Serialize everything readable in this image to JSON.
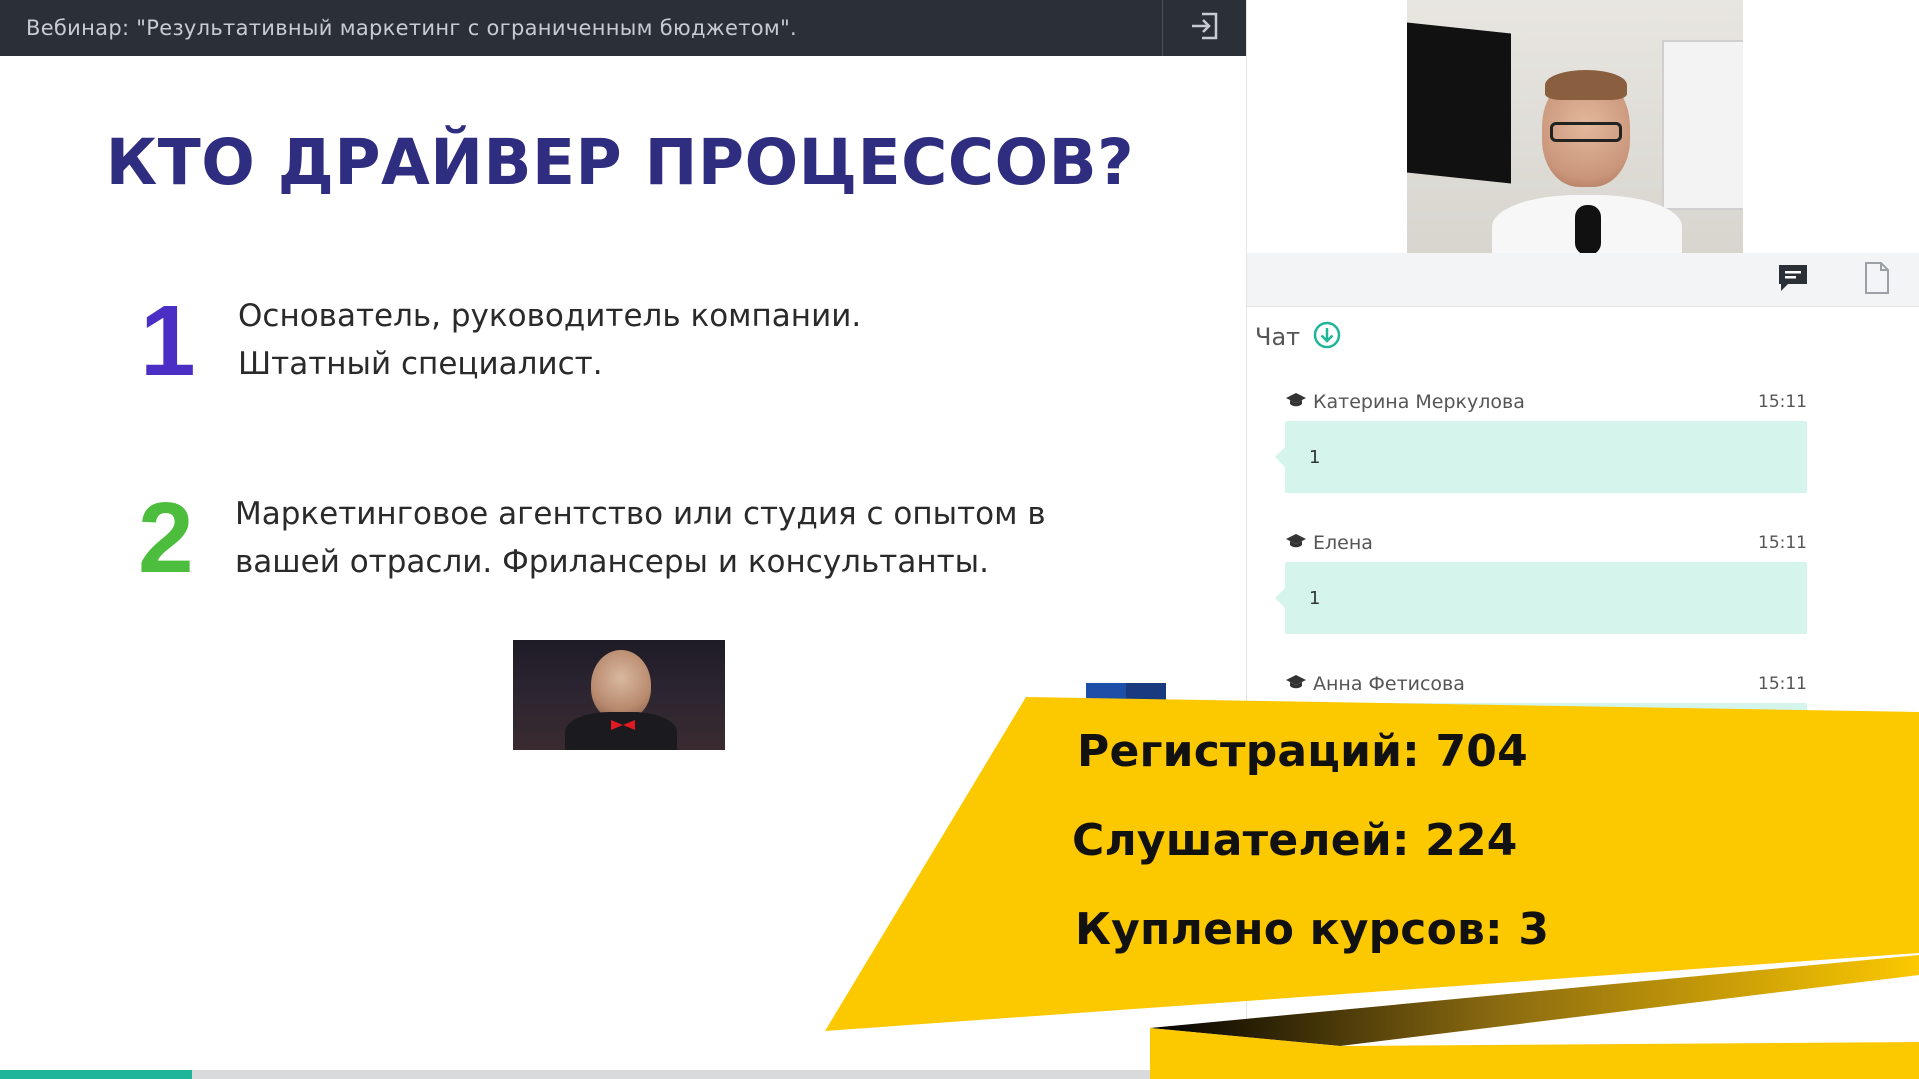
{
  "topbar": {
    "title": "Вебинар: \"Результативный маркетинг с ограниченным бюджетом\".",
    "exit_icon": "exit-icon"
  },
  "slide": {
    "title": "КТО ДРАЙВЕР ПРОЦЕССОВ?",
    "points": [
      {
        "number": "1",
        "lines": [
          "Основатель, руководитель компании.",
          "Штатный специалист."
        ]
      },
      {
        "number": "2",
        "lines": [
          "Маркетинговое агентство или студия с опытом в",
          "вашей отрасли. Фрилансеры и консультанты."
        ]
      }
    ]
  },
  "panel": {
    "tabs": [
      {
        "icon": "chat-icon"
      },
      {
        "icon": "file-icon"
      }
    ],
    "chat": {
      "label": "Чат",
      "messages": [
        {
          "author": "Катерина Меркулова",
          "time": "15:11",
          "text": "1"
        },
        {
          "author": "Елена",
          "time": "15:11",
          "text": "1"
        },
        {
          "author": "Анна Фетисова",
          "time": "15:11",
          "text": ""
        }
      ]
    }
  },
  "stats": {
    "registrations": "Регистраций: 704",
    "listeners": "Слушателей: 224",
    "courses_bought": "Куплено курсов: 3"
  },
  "progress": 0.1,
  "colors": {
    "topbar_bg": "#2b2f36",
    "title": "#2e2d80",
    "number_one": "#4b2fc4",
    "number_two": "#4cbd3c",
    "chat_bubble": "#d5f5ec",
    "accent": "#1fb59a",
    "banner_yellow": "#fcc800"
  }
}
